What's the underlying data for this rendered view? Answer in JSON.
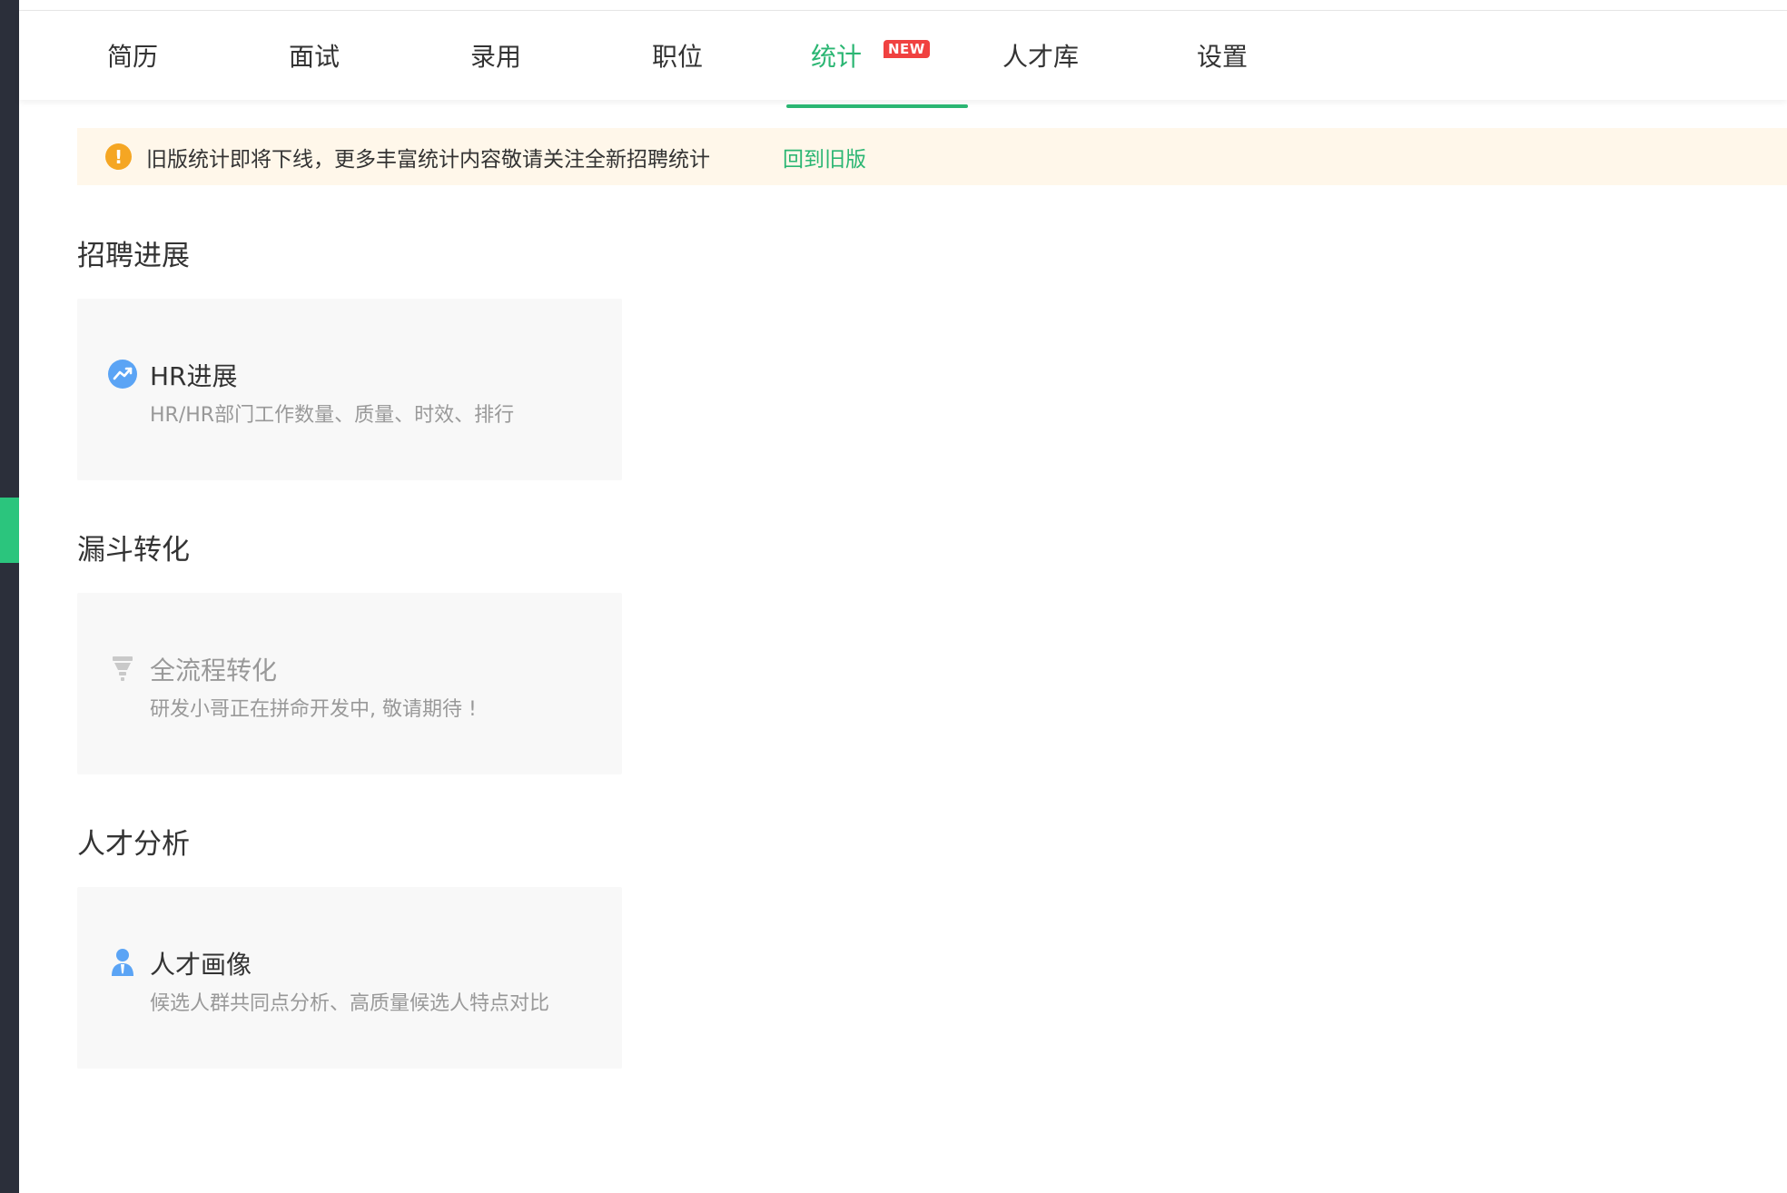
{
  "nav": {
    "tabs": [
      {
        "label": "简历"
      },
      {
        "label": "面试"
      },
      {
        "label": "录用"
      },
      {
        "label": "职位"
      },
      {
        "label": "统计",
        "badge": "NEW",
        "active": true
      },
      {
        "label": "人才库"
      },
      {
        "label": "设置"
      }
    ]
  },
  "notice": {
    "icon": "warning-icon",
    "text": "旧版统计即将下线，更多丰富统计内容敬请关注全新招聘统计",
    "link": "回到旧版"
  },
  "sections": [
    {
      "title": "招聘进展",
      "card": {
        "icon": "trend-icon",
        "title": "HR进展",
        "desc": "HR/HR部门工作数量、质量、时效、排行"
      }
    },
    {
      "title": "漏斗转化",
      "card": {
        "icon": "funnel-icon",
        "title": "全流程转化",
        "desc": "研发小哥正在拼命开发中, 敬请期待 !"
      }
    },
    {
      "title": "人才分析",
      "card": {
        "icon": "person-icon",
        "title": "人才画像",
        "desc": "候选人群共同点分析、高质量候选人特点对比"
      }
    }
  ],
  "colors": {
    "accent": "#2bb673",
    "badge": "#f04140",
    "notice_bg": "#fff7ea",
    "warning": "#f5a623",
    "icon_blue": "#5ba4f5"
  }
}
